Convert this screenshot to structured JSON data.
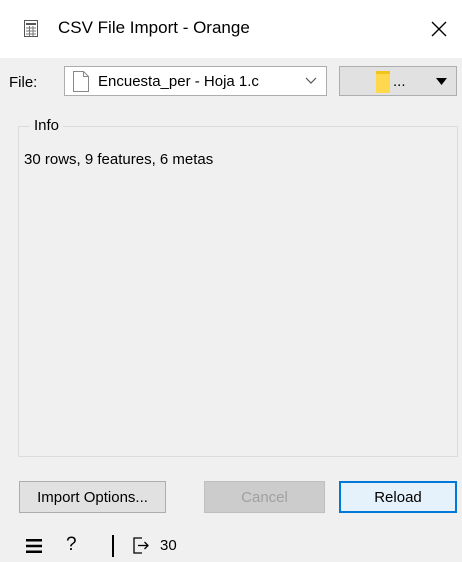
{
  "window": {
    "title": "CSV File Import - Orange",
    "app_icon": "spreadsheet-icon",
    "close_icon": "close-icon"
  },
  "file": {
    "label": "File:",
    "selected": "Encuesta_per - Hoja 1.c",
    "browse_label": "..."
  },
  "info": {
    "legend": "Info",
    "summary": "30 rows, 9 features, 6 metas"
  },
  "buttons": {
    "import_options": "Import Options...",
    "cancel": "Cancel",
    "reload": "Reload"
  },
  "status": {
    "output_count": "30"
  },
  "colors": {
    "window_bg": "#f0f0f0",
    "titlebar_bg": "#ffffff",
    "default_button_border": "#0078d7",
    "folder": "#ffd84d"
  }
}
